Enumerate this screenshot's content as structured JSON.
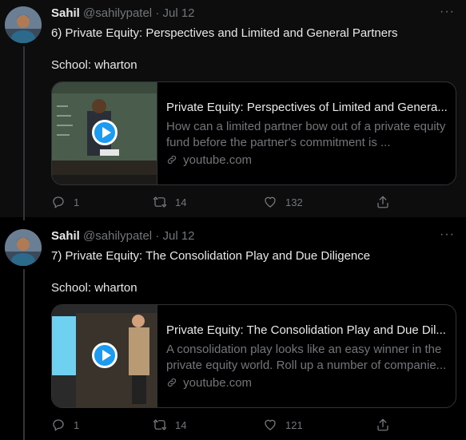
{
  "tweets": [
    {
      "author_name": "Sahil",
      "handle": "@sahilypatel",
      "separator": "·",
      "date": "Jul 12",
      "more": "···",
      "text": "6) Private Equity: Perspectives and Limited and General Partners",
      "school": "School: wharton",
      "card": {
        "title": "Private Equity: Perspectives of Limited and Genera...",
        "description": "How can a limited partner bow out of a private equity fund before the partner's commitment is ...",
        "domain": "youtube.com"
      },
      "replies": "1",
      "retweets": "14",
      "likes": "132"
    },
    {
      "author_name": "Sahil",
      "handle": "@sahilypatel",
      "separator": "·",
      "date": "Jul 12",
      "more": "···",
      "text": "7) Private Equity: The Consolidation Play and Due Diligence",
      "school": "School: wharton",
      "card": {
        "title": "Private Equity: The Consolidation Play and Due Dil...",
        "description": "A consolidation play looks like an easy winner in the private equity world. Roll up a number of companie...",
        "domain": "youtube.com"
      },
      "replies": "1",
      "retweets": "14",
      "likes": "121"
    }
  ],
  "icons": {
    "reply": "reply-icon",
    "retweet": "retweet-icon",
    "like": "heart-icon",
    "share": "share-icon",
    "link": "link-icon",
    "play": "play-icon"
  },
  "colors": {
    "background": "#000000",
    "text": "#e7e9ea",
    "muted": "#71767b",
    "accent": "#1d9bf0",
    "border": "#2f3336"
  }
}
